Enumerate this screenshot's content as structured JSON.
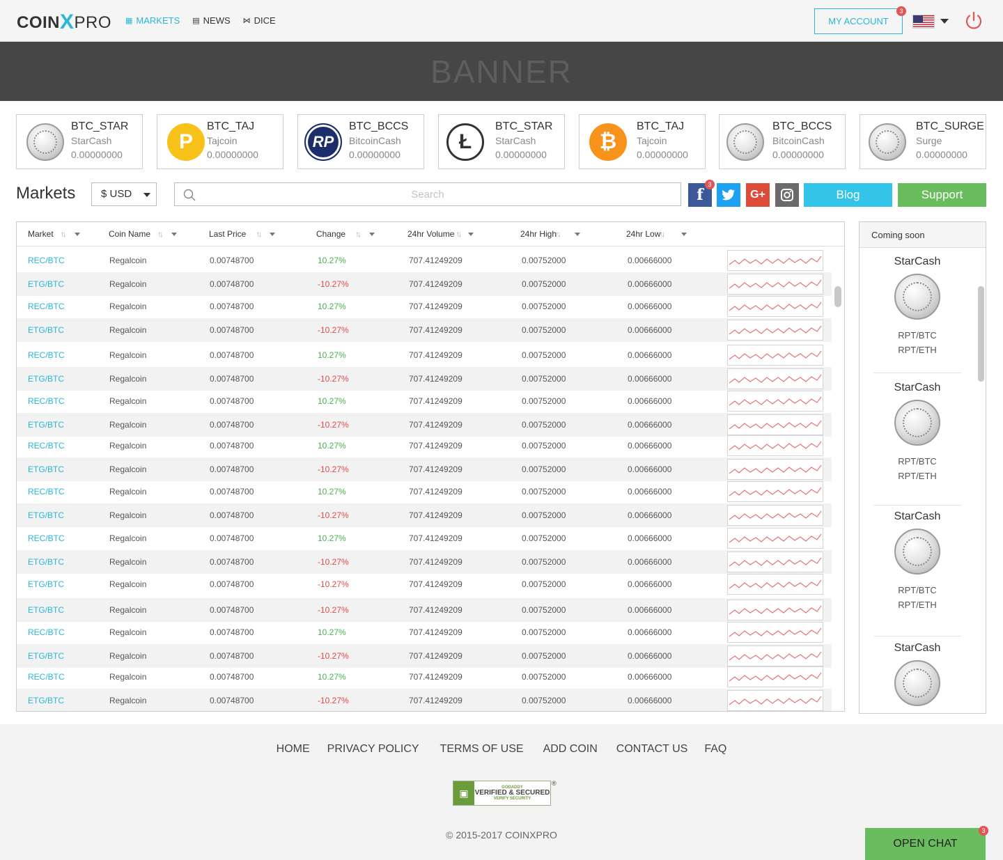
{
  "header": {
    "logo": {
      "coin": "CO",
      "i": "I",
      "n": "N",
      "x": "X",
      "pro": "PRO"
    },
    "nav": [
      {
        "label": "MARKETS",
        "icon": "store-icon",
        "active": true
      },
      {
        "label": "NEWS",
        "icon": "newspaper-icon",
        "active": false
      },
      {
        "label": "DICE",
        "icon": "dice-icon",
        "active": false
      }
    ],
    "my_account": "MY ACCOUNT",
    "account_badge": "3",
    "language_flag": "us-flag-icon"
  },
  "banner": {
    "text": "BANNER"
  },
  "tickers": [
    {
      "pair": "BTC_STAR",
      "name": "StarCash",
      "price": "0.00000000",
      "icon": "silver"
    },
    {
      "pair": "BTC_TAJ",
      "name": "Tajcoin",
      "price": "0.00000000",
      "icon": "taj"
    },
    {
      "pair": "BTC_BCCS",
      "name": "BitcoinCash",
      "price": "0.00000000",
      "icon": "bccs"
    },
    {
      "pair": "BTC_STAR",
      "name": "StarCash",
      "price": "0.00000000",
      "icon": "ltc"
    },
    {
      "pair": "BTC_TAJ",
      "name": "Tajcoin",
      "price": "0.00000000",
      "icon": "btc"
    },
    {
      "pair": "BTC_BCCS",
      "name": "BitcoinCash",
      "price": "0.00000000",
      "icon": "silver"
    },
    {
      "pair": "BTC_SURGE",
      "name": "Surge",
      "price": "0.00000000",
      "icon": "silver"
    }
  ],
  "markets": {
    "title": "Markets",
    "currency": "$ USD",
    "search_placeholder": "Search",
    "facebook_badge": "3",
    "blog": "Blog",
    "support": "Support"
  },
  "colors": {
    "accent": "#29b6d8",
    "positive": "#4caf50",
    "negative": "#e04a4a",
    "support": "#6abd5e",
    "blog": "#33c5e8",
    "facebook": "#3b5998",
    "twitter": "#1da1f2",
    "google": "#dd4b39",
    "instagram": "#6b6b6b"
  },
  "table": {
    "columns": [
      "Market",
      "Coin Name",
      "Last Price",
      "Change",
      "24hr Volume",
      "24hr High",
      "24hr Low"
    ],
    "rows": [
      {
        "market": "REC/BTC",
        "coin": "Regalcoin",
        "last": "0.00748700",
        "change": "10.27%",
        "volume": "707.41249209",
        "high": "0.00752000",
        "low": "0.00666000"
      },
      {
        "market": "ETG/BTC",
        "coin": "Regalcoin",
        "last": "0.00748700",
        "change": "-10.27%",
        "volume": "707.41249209",
        "high": "0.00752000",
        "low": "0.00666000"
      },
      {
        "market": "REC/BTC",
        "coin": "Regalcoin",
        "last": "0.00748700",
        "change": "10.27%",
        "volume": "707.41249209",
        "high": "0.00752000",
        "low": "0.00666000"
      },
      {
        "market": "ETG/BTC",
        "coin": "Regalcoin",
        "last": "0.00748700",
        "change": "-10.27%",
        "volume": "707.41249209",
        "high": "0.00752000",
        "low": "0.00666000"
      },
      {
        "market": "REC/BTC",
        "coin": "Regalcoin",
        "last": "0.00748700",
        "change": "10.27%",
        "volume": "707.41249209",
        "high": "0.00752000",
        "low": "0.00666000"
      },
      {
        "market": "ETG/BTC",
        "coin": "Regalcoin",
        "last": "0.00748700",
        "change": "-10.27%",
        "volume": "707.41249209",
        "high": "0.00752000",
        "low": "0.00666000"
      },
      {
        "market": "REC/BTC",
        "coin": "Regalcoin",
        "last": "0.00748700",
        "change": "10.27%",
        "volume": "707.41249209",
        "high": "0.00752000",
        "low": "0.00666000"
      },
      {
        "market": "ETG/BTC",
        "coin": "Regalcoin",
        "last": "0.00748700",
        "change": "-10.27%",
        "volume": "707.41249209",
        "high": "0.00752000",
        "low": "0.00666000"
      },
      {
        "market": "REC/BTC",
        "coin": "Regalcoin",
        "last": "0.00748700",
        "change": "10.27%",
        "volume": "707.41249209",
        "high": "0.00752000",
        "low": "0.00666000"
      },
      {
        "market": "ETG/BTC",
        "coin": "Regalcoin",
        "last": "0.00748700",
        "change": "-10.27%",
        "volume": "707.41249209",
        "high": "0.00752000",
        "low": "0.00666000"
      },
      {
        "market": "REC/BTC",
        "coin": "Regalcoin",
        "last": "0.00748700",
        "change": "10.27%",
        "volume": "707.41249209",
        "high": "0.00752000",
        "low": "0.00666000"
      },
      {
        "market": "ETG/BTC",
        "coin": "Regalcoin",
        "last": "0.00748700",
        "change": "-10.27%",
        "volume": "707.41249209",
        "high": "0.00752000",
        "low": "0.00666000"
      },
      {
        "market": "REC/BTC",
        "coin": "Regalcoin",
        "last": "0.00748700",
        "change": "10.27%",
        "volume": "707.41249209",
        "high": "0.00752000",
        "low": "0.00666000"
      },
      {
        "market": "ETG/BTC",
        "coin": "Regalcoin",
        "last": "0.00748700",
        "change": "-10.27%",
        "volume": "707.41249209",
        "high": "0.00752000",
        "low": "0.00666000"
      },
      {
        "market": "ETG/BTC",
        "coin": "Regalcoin",
        "last": "0.00748700",
        "change": "-10.27%",
        "volume": "707.41249209",
        "high": "0.00752000",
        "low": "0.00666000"
      },
      {
        "market": "ETG/BTC",
        "coin": "Regalcoin",
        "last": "0.00748700",
        "change": "-10.27%",
        "volume": "707.41249209",
        "high": "0.00752000",
        "low": "0.00666000"
      },
      {
        "market": "REC/BTC",
        "coin": "Regalcoin",
        "last": "0.00748700",
        "change": "10.27%",
        "volume": "707.41249209",
        "high": "0.00752000",
        "low": "0.00666000"
      },
      {
        "market": "ETG/BTC",
        "coin": "Regalcoin",
        "last": "0.00748700",
        "change": "-10.27%",
        "volume": "707.41249209",
        "high": "0.00752000",
        "low": "0.00666000"
      },
      {
        "market": "REC/BTC",
        "coin": "Regalcoin",
        "last": "0.00748700",
        "change": "10.27%",
        "volume": "707.41249209",
        "high": "0.00752000",
        "low": "0.00666000"
      },
      {
        "market": "ETG/BTC",
        "coin": "Regalcoin",
        "last": "0.00748700",
        "change": "-10.27%",
        "volume": "707.41249209",
        "high": "0.00752000",
        "low": "0.00666000"
      }
    ]
  },
  "coming_soon": {
    "title": "Coming soon",
    "items": [
      {
        "name": "StarCash",
        "pairs": [
          "RPT/BTC",
          "RPT/ETH"
        ]
      },
      {
        "name": "StarCash",
        "pairs": [
          "RPT/BTC",
          "RPT/ETH"
        ]
      },
      {
        "name": "StarCash",
        "pairs": [
          "RPT/BTC",
          "RPT/ETH"
        ]
      },
      {
        "name": "StarCash",
        "pairs": []
      }
    ]
  },
  "footer": {
    "links": [
      "HOME",
      "PRIVACY POLICY",
      "TERMS OF USE",
      "ADD COIN",
      "CONTACT US",
      "FAQ"
    ],
    "seal": {
      "line1": "GODADDY",
      "line2": "VERIFIED & SECURED",
      "line3": "VERIFY SECURITY",
      "reg": "®"
    },
    "copyright": "© 2015-2017 COINXPRO"
  },
  "chat": {
    "label": "OPEN CHAT",
    "badge": "3"
  }
}
